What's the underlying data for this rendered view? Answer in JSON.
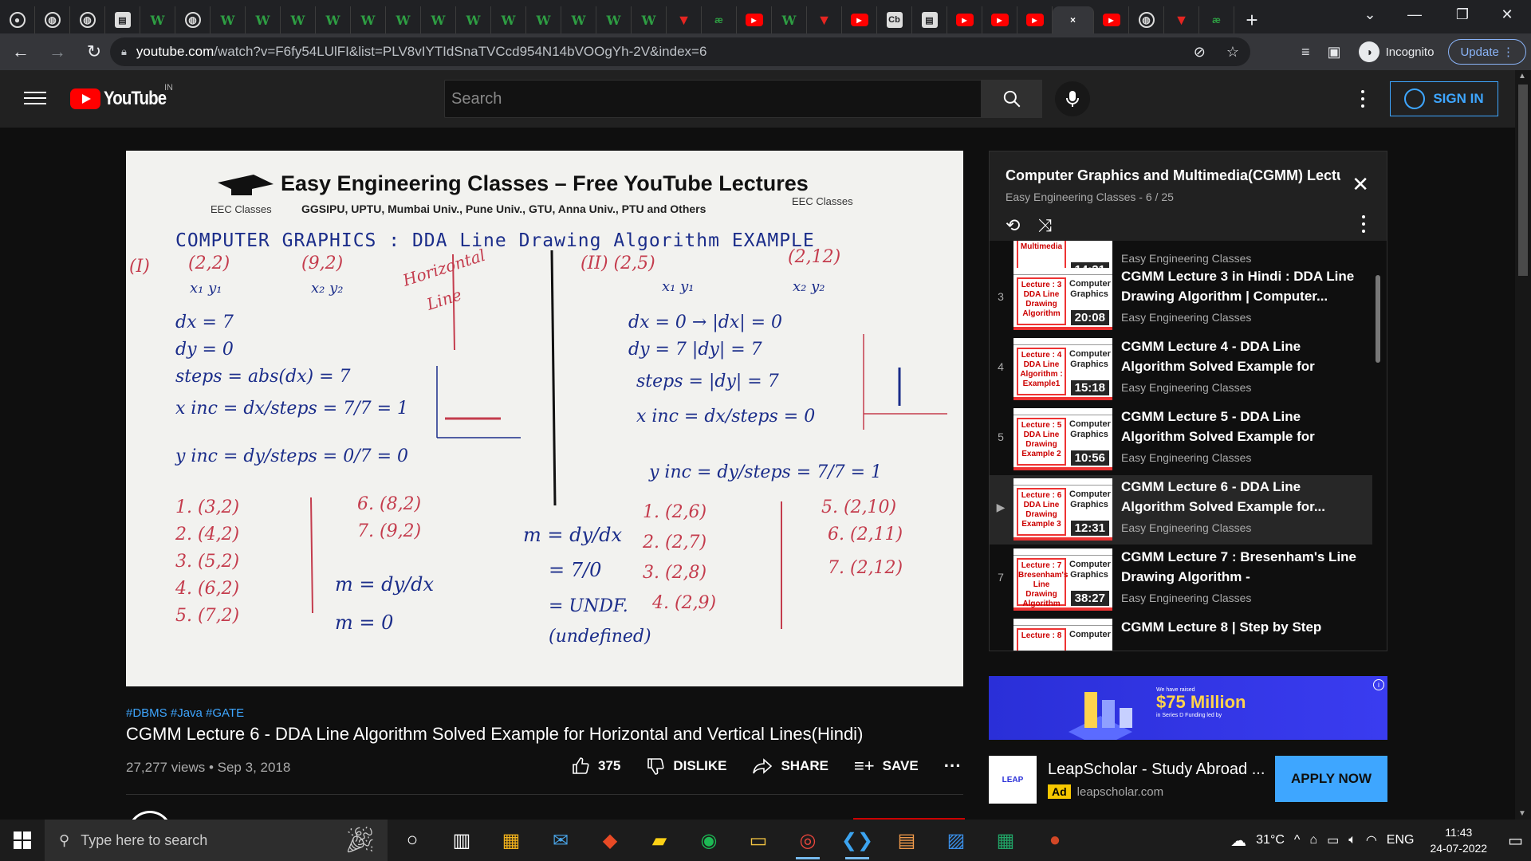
{
  "browser": {
    "tabs": [
      {
        "icon": "github-icon",
        "glyph": "●",
        "cls": "circ"
      },
      {
        "icon": "globe-icon",
        "glyph": "◍",
        "cls": "circ"
      },
      {
        "icon": "globe-icon",
        "glyph": "◍",
        "cls": "circ"
      },
      {
        "icon": "doc-icon",
        "glyph": "▤",
        "cls": "sq"
      },
      {
        "icon": "w-icon",
        "glyph": "W",
        "cls": "w"
      },
      {
        "icon": "globe-icon",
        "glyph": "◍",
        "cls": "circ"
      },
      {
        "icon": "w-icon",
        "glyph": "W",
        "cls": "w"
      },
      {
        "icon": "w-icon",
        "glyph": "W",
        "cls": "w"
      },
      {
        "icon": "w-icon",
        "glyph": "W",
        "cls": "w"
      },
      {
        "icon": "w-icon",
        "glyph": "W",
        "cls": "w"
      },
      {
        "icon": "w-icon",
        "glyph": "W",
        "cls": "w"
      },
      {
        "icon": "w-icon",
        "glyph": "W",
        "cls": "w"
      },
      {
        "icon": "w-icon",
        "glyph": "W",
        "cls": "w"
      },
      {
        "icon": "w-icon",
        "glyph": "W",
        "cls": "w"
      },
      {
        "icon": "w-icon",
        "glyph": "W",
        "cls": "w"
      },
      {
        "icon": "w-icon",
        "glyph": "W",
        "cls": "w"
      },
      {
        "icon": "w-icon",
        "glyph": "W",
        "cls": "w"
      },
      {
        "icon": "w-icon",
        "glyph": "W",
        "cls": "w"
      },
      {
        "icon": "w-icon",
        "glyph": "W",
        "cls": "w"
      },
      {
        "icon": "vivaldi-icon",
        "glyph": "▼",
        "cls": "v"
      },
      {
        "icon": "ab-icon",
        "glyph": "æ",
        "cls": "ab"
      },
      {
        "icon": "youtube-icon",
        "glyph": "▶",
        "cls": "yt"
      },
      {
        "icon": "w-icon",
        "glyph": "W",
        "cls": "w"
      },
      {
        "icon": "vivaldi-icon",
        "glyph": "▼",
        "cls": "v"
      },
      {
        "icon": "youtube-icon",
        "glyph": "▶",
        "cls": "yt"
      },
      {
        "icon": "cb-icon",
        "glyph": "Cb",
        "cls": "sq"
      },
      {
        "icon": "doc-icon",
        "glyph": "▤",
        "cls": "sq"
      },
      {
        "icon": "youtube-icon",
        "glyph": "▶",
        "cls": "yt"
      },
      {
        "icon": "youtube-icon",
        "glyph": "▶",
        "cls": "yt"
      },
      {
        "icon": "youtube-icon",
        "glyph": "▶",
        "cls": "yt"
      },
      {
        "icon": "close-icon",
        "glyph": "×",
        "cls": "active"
      },
      {
        "icon": "youtube-icon",
        "glyph": "▶",
        "cls": "yt"
      },
      {
        "icon": "globe-icon",
        "glyph": "◍",
        "cls": "circ"
      },
      {
        "icon": "vivaldi-icon",
        "glyph": "▼",
        "cls": "v"
      },
      {
        "icon": "ab-icon",
        "glyph": "æ",
        "cls": "ab"
      }
    ],
    "url_host": "youtube.com",
    "url_rest": "/watch?v=F6fy54LUlFI&list=PLV8vIYTIdSnaTVCcd954N14bVOOgYh-2V&index=6",
    "incognito_label": "Incognito",
    "update_label": "Update"
  },
  "yt": {
    "logo_text": "YouTube",
    "country_code": "IN",
    "search_placeholder": "Search",
    "signin_label": "SIGN IN"
  },
  "video": {
    "board_title": "Easy Engineering Classes – Free YouTube Lectures",
    "board_subtitle": "GGSIPU, UPTU, Mumbai Univ., Pune Univ., GTU, Anna Univ., PTU and Others",
    "board_brand_left": "EEC Classes",
    "board_brand_right": "EEC Classes",
    "board_heading": "COMPUTER  GRAPHICS : DDA Line Drawing Algorithm EXAMPLE",
    "hashtags": "#DBMS #Java #GATE",
    "title": "CGMM Lecture 6 - DDA Line Algorithm Solved Example for Horizontal and Vertical Lines(Hindi)",
    "views": "27,277 views",
    "date": "Sep 3, 2018",
    "meta_sep": " • ",
    "likes": "375",
    "dislike_label": "DISLIKE",
    "share_label": "SHARE",
    "save_label": "SAVE"
  },
  "playlist": {
    "title": "Computer Graphics and Multimedia(CGMM) Lectur...",
    "channel": "Easy Engineering Classes",
    "position": "6 / 25",
    "items": [
      {
        "idx": "",
        "thumb_l": "and Multimedia",
        "thumb_r": "",
        "dur": "14:31",
        "title": "",
        "channel": "Easy Engineering Classes"
      },
      {
        "idx": "3",
        "thumb_l": "Lecture : 3 DDA Line Drawing Algorithm",
        "thumb_r": "Computer Graphics",
        "dur": "20:08",
        "title": "CGMM Lecture 3 in Hindi : DDA Line Drawing Algorithm | Computer...",
        "channel": "Easy Engineering Classes"
      },
      {
        "idx": "4",
        "thumb_l": "Lecture : 4 DDA Line Algorithm : Example1",
        "thumb_r": "Computer Graphics",
        "dur": "15:18",
        "title": "CGMM Lecture 4 - DDA Line Algorithm Solved Example for Lines...",
        "channel": "Easy Engineering Classes"
      },
      {
        "idx": "5",
        "thumb_l": "Lecture : 5 DDA Line Drawing Example 2",
        "thumb_r": "Computer Graphics",
        "dur": "10:56",
        "title": "CGMM Lecture 5 - DDA Line Algorithm Solved Example for Lines...",
        "channel": "Easy Engineering Classes"
      },
      {
        "idx": "▶",
        "thumb_l": "Lecture : 6 DDA Line Drawing Example 3",
        "thumb_r": "Computer Graphics",
        "dur": "12:31",
        "title": "CGMM Lecture 6 - DDA Line Algorithm Solved Example for...",
        "channel": "Easy Engineering Classes"
      },
      {
        "idx": "7",
        "thumb_l": "Lecture : 7 Bresenham's Line Drawing Algorithm",
        "thumb_r": "Computer Graphics",
        "dur": "38:27",
        "title": "CGMM Lecture 7 : Bresenham's Line Drawing Algorithm - Disadvantages...",
        "channel": "Easy Engineering Classes"
      },
      {
        "idx": "",
        "thumb_l": "Lecture : 8",
        "thumb_r": "Computer",
        "dur": "",
        "title": "CGMM Lecture 8 | Step by Step",
        "channel": ""
      }
    ]
  },
  "ad": {
    "banner_small": "We have raised",
    "banner_amount": "$75 Million",
    "banner_small2": "in Series D Funding led by",
    "info": "i",
    "logo_text": "LEAP",
    "title": "LeapScholar - Study Abroad ...",
    "tag": "Ad",
    "domain": "leapscholar.com",
    "cta": "APPLY NOW"
  },
  "taskbar": {
    "search_placeholder": "Type here to search",
    "temperature": "31°C",
    "lang": "ENG",
    "time": "11:43",
    "date": "24-07-2022"
  },
  "colors": {
    "yt_red": "#ff0000",
    "link_blue": "#3ea6ff",
    "bg": "#0f0f0f"
  }
}
